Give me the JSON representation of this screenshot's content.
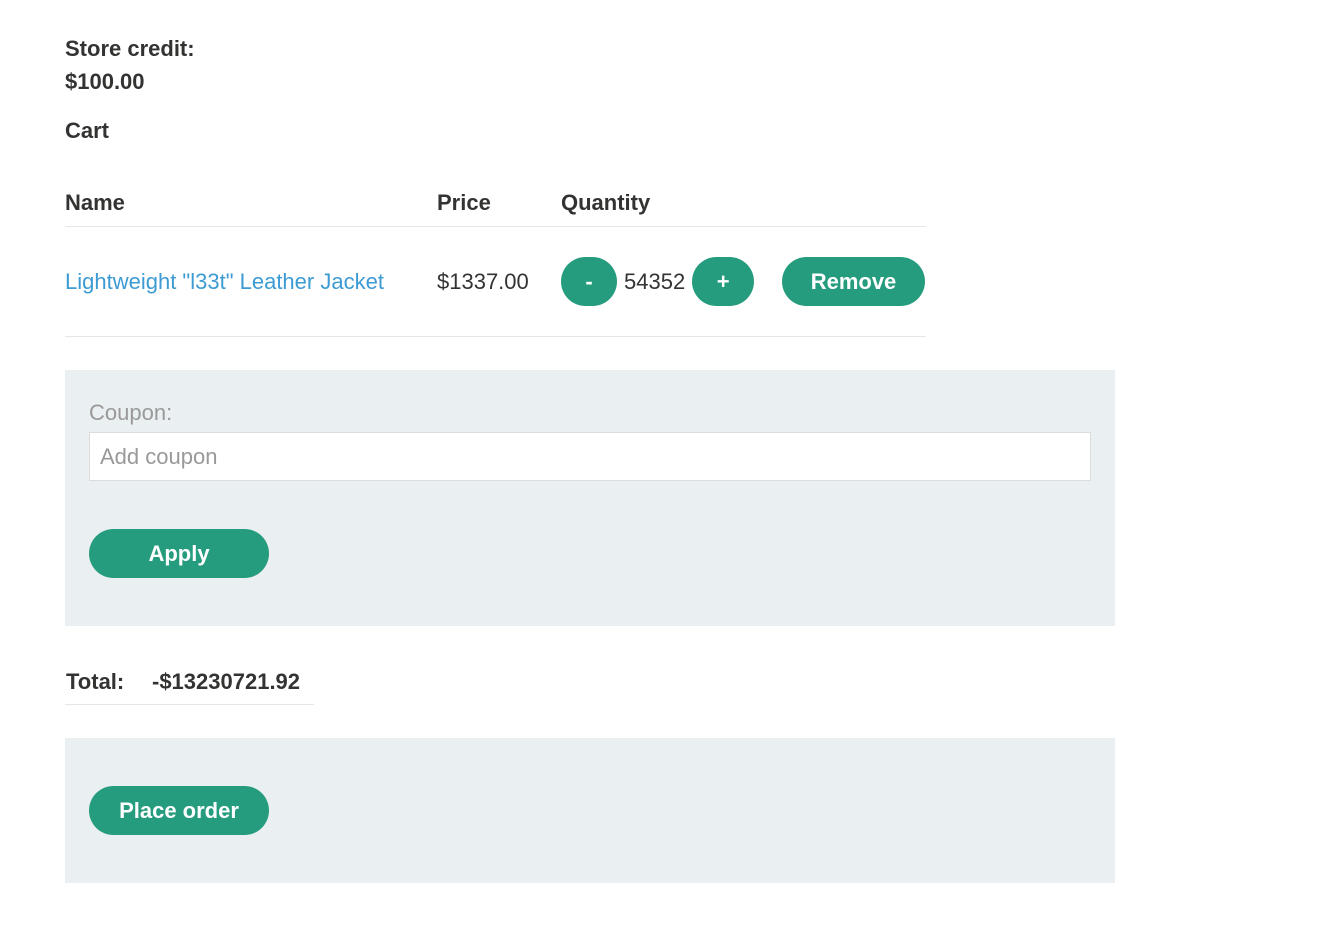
{
  "account": {
    "store_credit_label": "Store credit:",
    "store_credit_value": "$100.00"
  },
  "cart": {
    "heading": "Cart",
    "columns": {
      "name": "Name",
      "price": "Price",
      "quantity": "Quantity"
    },
    "items": [
      {
        "name": "Lightweight \"l33t\" Leather Jacket",
        "price": "$1337.00",
        "quantity": "54352",
        "decrement_label": "-",
        "increment_label": "+",
        "remove_label": "Remove"
      }
    ]
  },
  "coupon": {
    "label": "Coupon:",
    "placeholder": "Add coupon",
    "value": "",
    "apply_label": "Apply"
  },
  "totals": {
    "label": "Total:",
    "value": "-$13230721.92"
  },
  "order": {
    "place_order_label": "Place order"
  },
  "colors": {
    "accent": "#259c7e",
    "link": "#3d9bd4",
    "panel_background": "#eaeff1",
    "text": "#333332",
    "muted_text": "#999999"
  }
}
